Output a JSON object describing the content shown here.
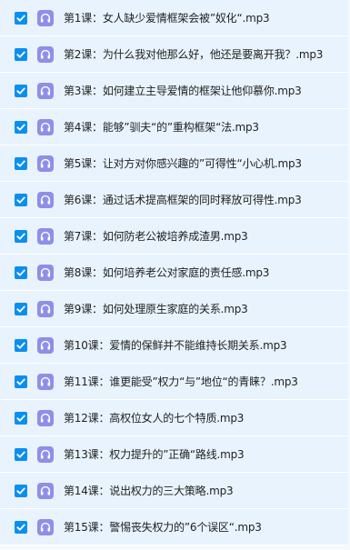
{
  "icons": {
    "checkbox": "checkbox-checked-icon",
    "file": "audio-headphones-icon"
  },
  "colors": {
    "row_bg": "#e8f3fe",
    "checkbox": "#0a8ff0",
    "audio_icon_bg": "#8f8ee8",
    "text": "#222222"
  },
  "files": [
    {
      "name": "第1课：女人缺少爱情框架会被”奴化“.mp3",
      "checked": true
    },
    {
      "name": "第2课：为什么我对他那么好，他还是要离开我？.mp3",
      "checked": true
    },
    {
      "name": "第3课：如何建立主导爱情的框架让他仰慕你.mp3",
      "checked": true
    },
    {
      "name": "第4课：能够”驯夫“的”重构框架“法.mp3",
      "checked": true
    },
    {
      "name": "第5课：让对方对你感兴趣的”可得性“小心机.mp3",
      "checked": true
    },
    {
      "name": "第6课：通过话术提高框架的同时释放可得性.mp3",
      "checked": true
    },
    {
      "name": "第7课：如何防老公被培养成渣男.mp3",
      "checked": true
    },
    {
      "name": "第8课：如何培养老公对家庭的责任感.mp3",
      "checked": true
    },
    {
      "name": "第9课：如何处理原生家庭的关系.mp3",
      "checked": true
    },
    {
      "name": "第10课：爱情的保鲜并不能维持长期关系.mp3",
      "checked": true
    },
    {
      "name": "第11课：谁更能受”权力“与”地位“的青睐？.mp3",
      "checked": true
    },
    {
      "name": "第12课：高权位女人的七个特质.mp3",
      "checked": true
    },
    {
      "name": "第13课：权力提升的”正确“路线.mp3",
      "checked": true
    },
    {
      "name": "第14课：说出权力的三大策略.mp3",
      "checked": true
    },
    {
      "name": "第15课：警惕丧失权力的”6个误区“.mp3",
      "checked": true
    }
  ]
}
